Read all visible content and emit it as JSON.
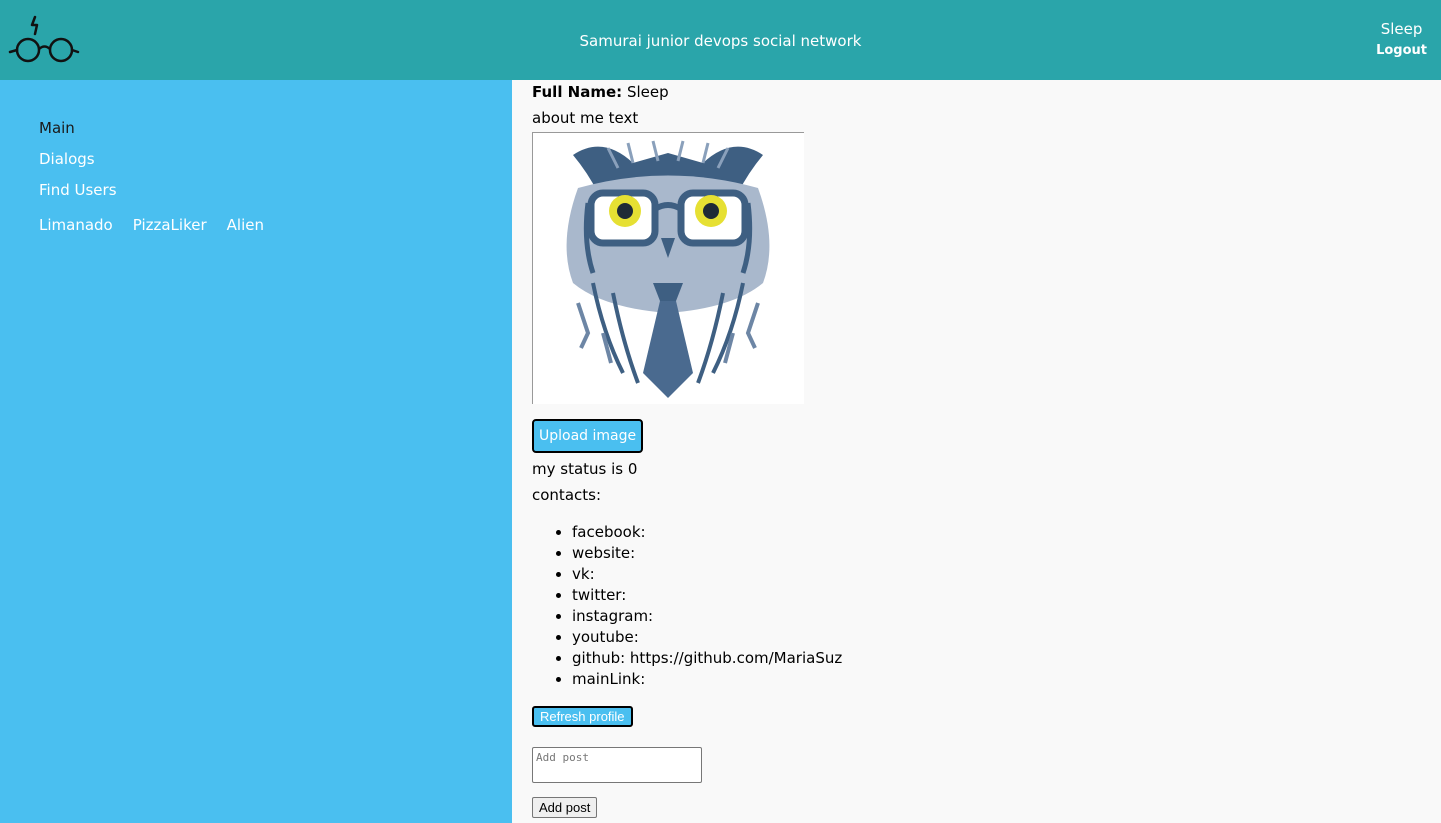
{
  "header": {
    "title": "Samurai junior devops social network",
    "login_name": "Sleep",
    "logout_label": "Logout",
    "logo_icon": "glasses-logo-icon"
  },
  "sidebar": {
    "items": [
      {
        "label": "Main"
      },
      {
        "label": "Dialogs"
      },
      {
        "label": "Find Users"
      }
    ],
    "friends": [
      "Limanado",
      "PizzaLiker",
      "Alien"
    ]
  },
  "profile": {
    "full_name_label": "Full Name:",
    "full_name": "Sleep",
    "about_me": "about me text",
    "avatar_icon": "owl-with-glasses-icon",
    "upload_label": "Upload image",
    "status": "my status is 0",
    "contacts_label": "contacts:",
    "contacts": [
      "facebook:",
      "website:",
      "vk:",
      "twitter:",
      "instagram:",
      "youtube:",
      "github: https://github.com/MariaSuz",
      "mainLink:"
    ],
    "refresh_label": "Refresh profile",
    "post_placeholder": "Add post",
    "add_post_label": "Add post"
  },
  "colors": {
    "header_bg": "#2aa5aa",
    "sidebar_bg": "#4abff0",
    "content_bg": "#f9f9f9",
    "button_bg": "#4abff0"
  }
}
